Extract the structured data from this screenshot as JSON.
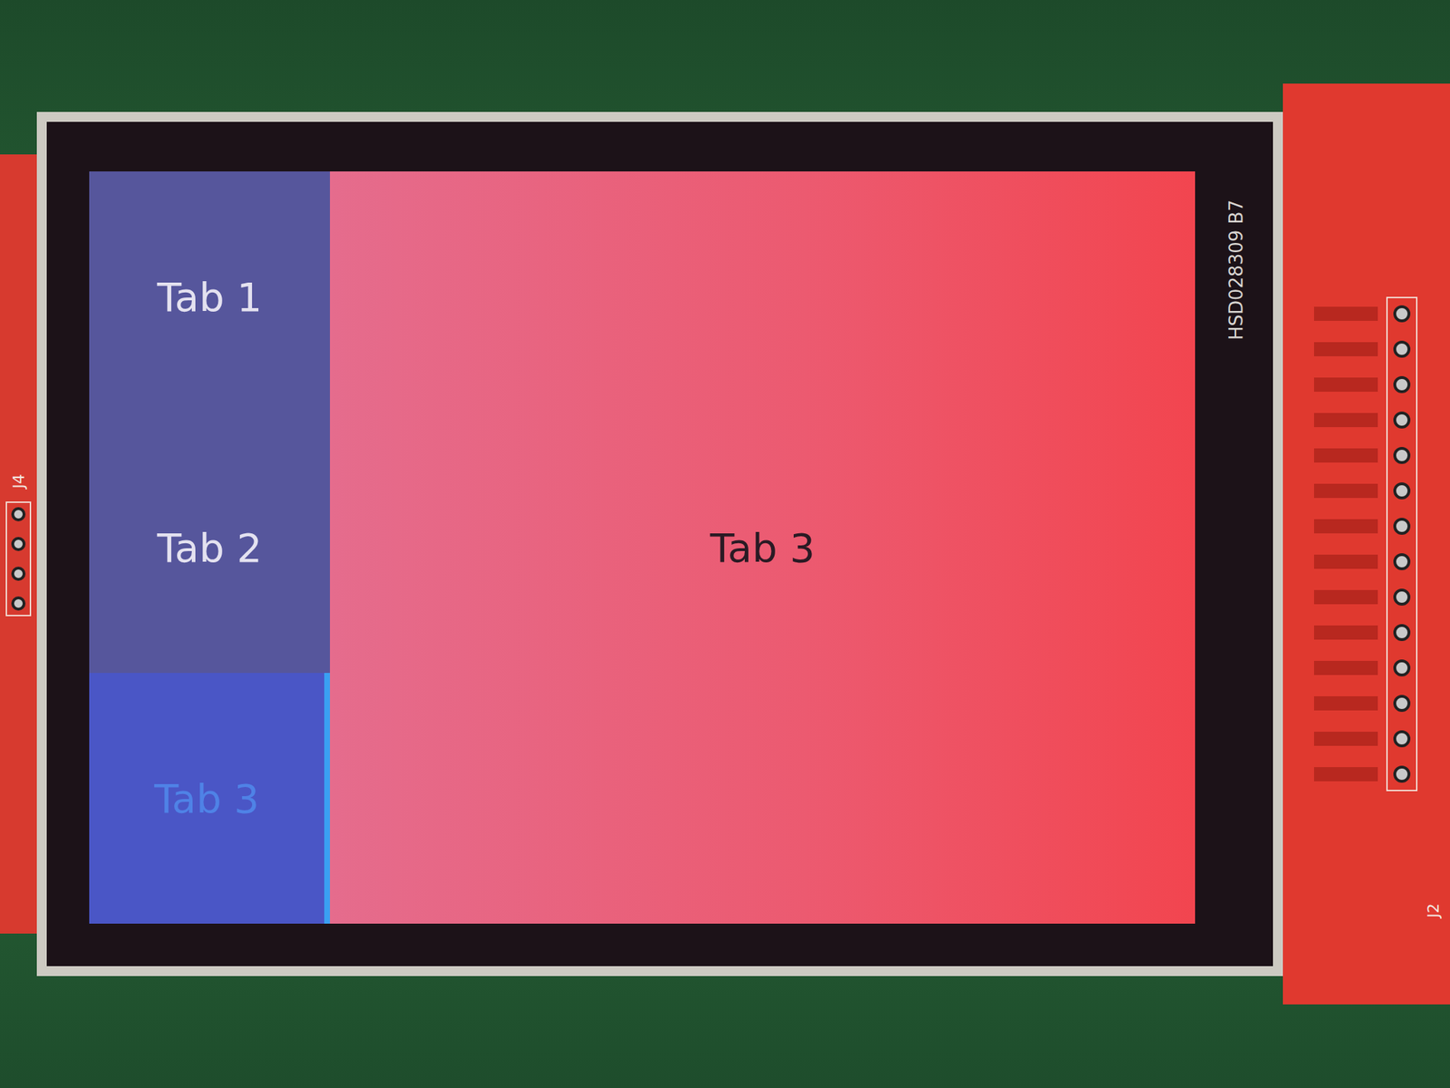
{
  "tabs": [
    {
      "label": "Tab 1",
      "selected": false
    },
    {
      "label": "Tab 2",
      "selected": false
    },
    {
      "label": "Tab 3",
      "selected": true
    }
  ],
  "content": {
    "text": "Tab 3"
  },
  "silkscreen": {
    "display_label": "HSD028309 B7",
    "left_connector": "J4",
    "right_connector": "J2"
  }
}
